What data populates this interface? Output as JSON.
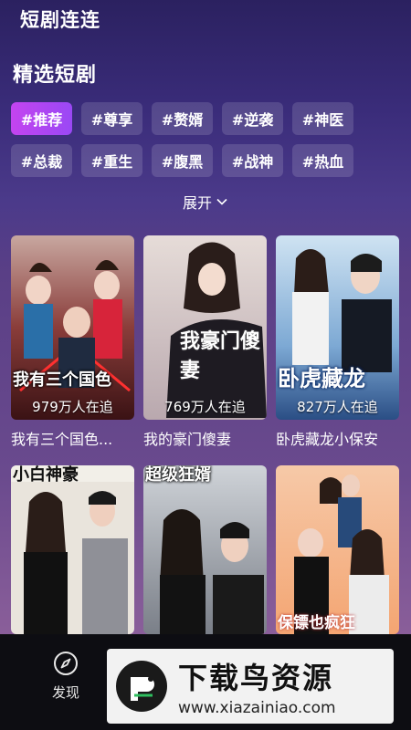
{
  "header": {
    "app_title": "短剧连连"
  },
  "section": {
    "title": "精选短剧"
  },
  "tags": [
    {
      "label": "#推荐",
      "active": true
    },
    {
      "label": "#尊享",
      "active": false
    },
    {
      "label": "#赘婿",
      "active": false
    },
    {
      "label": "#逆袭",
      "active": false
    },
    {
      "label": "#神医",
      "active": false
    },
    {
      "label": "#总裁",
      "active": false
    },
    {
      "label": "#重生",
      "active": false
    },
    {
      "label": "#腹黑",
      "active": false
    },
    {
      "label": "#战神",
      "active": false
    },
    {
      "label": "#热血",
      "active": false
    }
  ],
  "expand": {
    "label": "展开"
  },
  "dramas": [
    {
      "title": "我有三个国色...",
      "views": "979万人在追",
      "poster_text": "我有三个国色"
    },
    {
      "title": "我的豪门傻妻",
      "views": "769万人在追",
      "poster_text": "我豪门傻妻"
    },
    {
      "title": "卧虎藏龙小保安",
      "views": "827万人在追",
      "poster_text": "卧虎藏龙"
    },
    {
      "title": "",
      "views": "",
      "poster_text": "小白神豪"
    },
    {
      "title": "",
      "views": "",
      "poster_text": "超级狂婿"
    },
    {
      "title": "",
      "views": "",
      "poster_text": "保镖也疯狂"
    }
  ],
  "bottom_nav": {
    "discover_label": "发现"
  },
  "watermark": {
    "main": "下载鸟资源",
    "url": "www.xiazainiao.com"
  },
  "colors": {
    "accent": "#b046f2",
    "bottom_bar": "#0d0d12"
  }
}
